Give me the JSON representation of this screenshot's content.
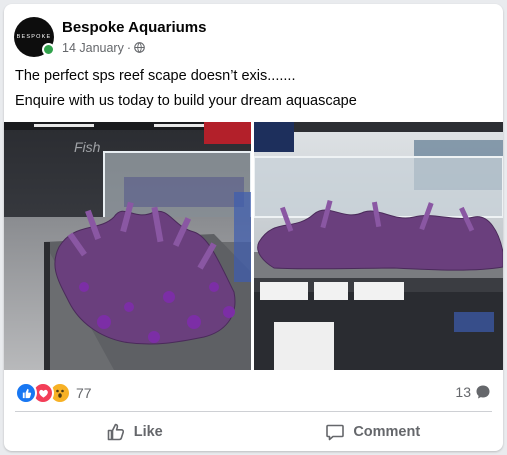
{
  "post": {
    "page_name": "Bespoke Aquariums",
    "date": "14 January",
    "privacy_icon": "globe-icon",
    "avatar_logo_text": "BESPOKE",
    "caption_line1": "The perfect sps reef scape doesn’t exis.......",
    "caption_line2": "Enquire with us today to build your dream aquascape"
  },
  "photos": [
    {
      "name": "reef-scape-photo-1",
      "subject": "purple sps reef rockscape in empty aquarium"
    },
    {
      "name": "reef-scape-photo-2",
      "subject": "purple sps reef rockscape in empty aquarium"
    }
  ],
  "engagement": {
    "reaction_icons": [
      "like-icon",
      "love-icon",
      "wow-icon"
    ],
    "reaction_count": "77",
    "comment_count": "13"
  },
  "actions": {
    "like_label": "Like",
    "comment_label": "Comment"
  },
  "colors": {
    "like_blue": "#1877f2",
    "love_red": "#f33e58",
    "wow_yellow": "#f7b125",
    "online_green": "#31a24c",
    "secondary_text": "#65676b",
    "rock_purple": "#6a3f7d"
  }
}
